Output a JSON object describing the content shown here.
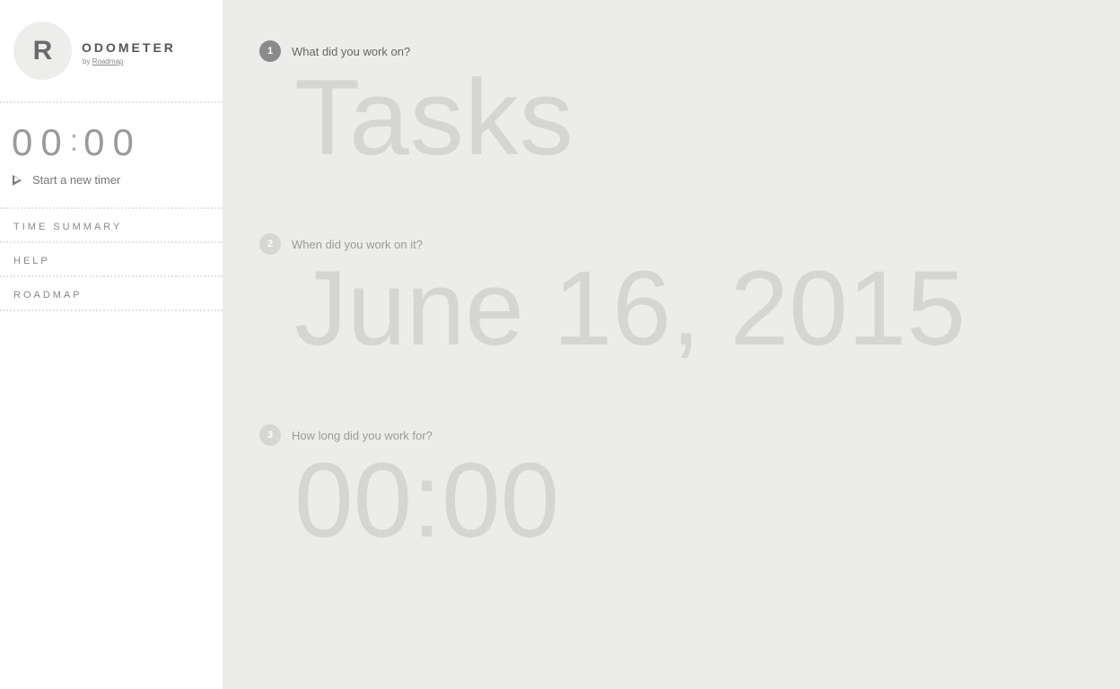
{
  "brand": {
    "logo_letter": "R",
    "name": "ODOMETER",
    "by_prefix": "by",
    "by_link": "Roadmap"
  },
  "timer": {
    "hours": "00",
    "colon": ":",
    "minutes": "00",
    "start_label": "Start a new timer"
  },
  "nav": {
    "items": [
      {
        "label": "TIME SUMMARY"
      },
      {
        "label": "HELP"
      },
      {
        "label": "ROADMAP"
      }
    ]
  },
  "form": {
    "steps": [
      {
        "number": "1",
        "question": "What did you work on?",
        "value": "Tasks",
        "state": "active"
      },
      {
        "number": "2",
        "question": "When did you work on it?",
        "value": "June 16, 2015",
        "state": "inactive"
      },
      {
        "number": "3",
        "question": "How long did you work for?",
        "value": "00:00",
        "state": "inactive"
      }
    ]
  },
  "colors": {
    "sidebar_bg": "#ffffff",
    "main_bg": "#ececea",
    "placeholder_text": "#d5d5d3",
    "active_badge": "#8a8a8a",
    "inactive_badge": "#d6d6d4"
  },
  "icons": {
    "start_timer": "play-icon"
  }
}
